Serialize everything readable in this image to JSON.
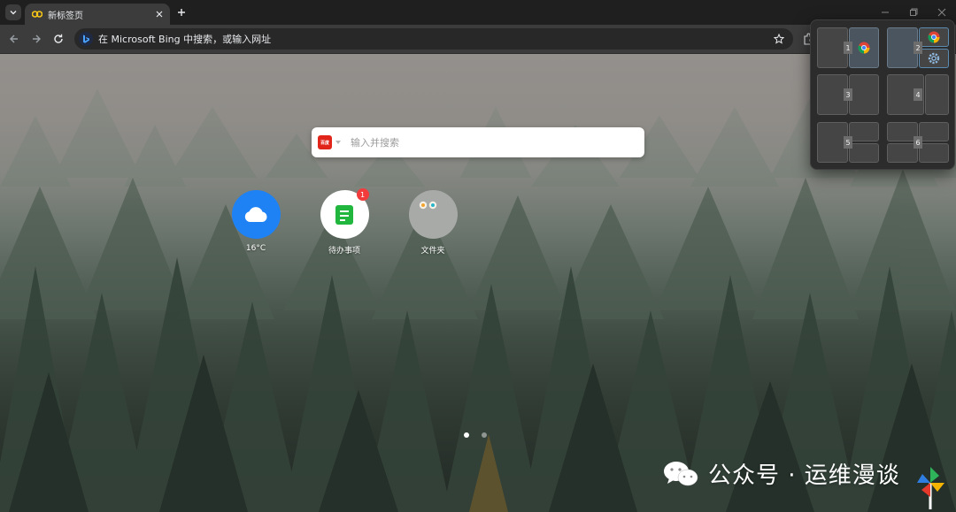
{
  "browser": {
    "tab": {
      "title": "新标签页"
    },
    "omnibox": {
      "text": "在 Microsoft Bing 中搜索，或输入网址"
    }
  },
  "newtab": {
    "search": {
      "engine_badge": "百度",
      "placeholder": "输入并搜索"
    },
    "shortcuts": [
      {
        "label": "16°C",
        "icon": "cloud-icon",
        "color": "#1e82f5"
      },
      {
        "label": "待办事项",
        "icon": "todo-note-icon",
        "color": "#ffffff",
        "badge": "1"
      },
      {
        "label": "文件夹",
        "icon": "folder-group-icon",
        "color": "#a8aaa8"
      }
    ],
    "pages": {
      "count": 2,
      "current": 1
    }
  },
  "snap_layouts": {
    "layouts": [
      {
        "id": "layout-1",
        "zones": [
          "1"
        ]
      },
      {
        "id": "layout-2",
        "zones": [
          "2"
        ]
      },
      {
        "id": "layout-3",
        "zones": [
          "3"
        ]
      },
      {
        "id": "layout-4",
        "zones": [
          "4"
        ]
      },
      {
        "id": "layout-5",
        "zones": [
          "5"
        ]
      },
      {
        "id": "layout-6",
        "zones": [
          "6"
        ]
      }
    ]
  },
  "watermark": {
    "text": "公众号 · 运维漫谈"
  },
  "colors": {
    "accent": "#1e82f5",
    "badge": "#f23c3c",
    "baidu": "#e1251b"
  }
}
